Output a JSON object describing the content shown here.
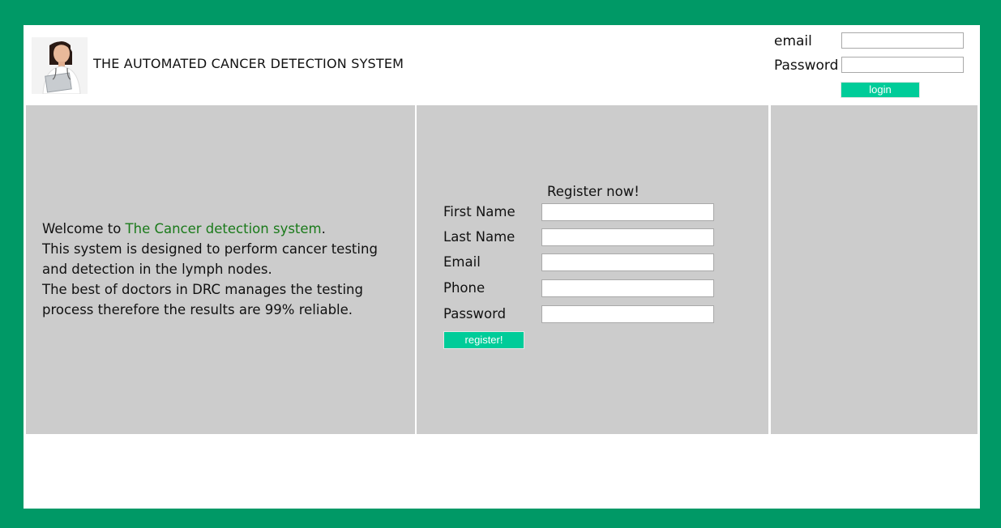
{
  "header": {
    "title": "THE AUTOMATED CANCER DETECTION SYSTEM",
    "login": {
      "email_label": "email",
      "email_value": "",
      "password_label": "Password",
      "password_value": "",
      "login_label": "login"
    }
  },
  "welcome": {
    "prefix": "Welcome to ",
    "highlight": "The Cancer detection system",
    "suffix": ".",
    "line2": "This system is designed to perform cancer testing and detection in the lymph nodes.",
    "line3": "The best of doctors in DRC manages the testing process therefore the results are 99% reliable."
  },
  "register": {
    "title": "Register now!",
    "fields": [
      {
        "label": "First Name",
        "value": ""
      },
      {
        "label": "Last Name",
        "value": ""
      },
      {
        "label": "Email",
        "value": ""
      },
      {
        "label": "Phone",
        "value": ""
      },
      {
        "label": "Password",
        "value": ""
      }
    ],
    "button_label": "register!"
  },
  "colors": {
    "frame": "#009966",
    "accent": "#00cc99",
    "panel": "#cccccc",
    "highlight": "#1a7a1a"
  }
}
